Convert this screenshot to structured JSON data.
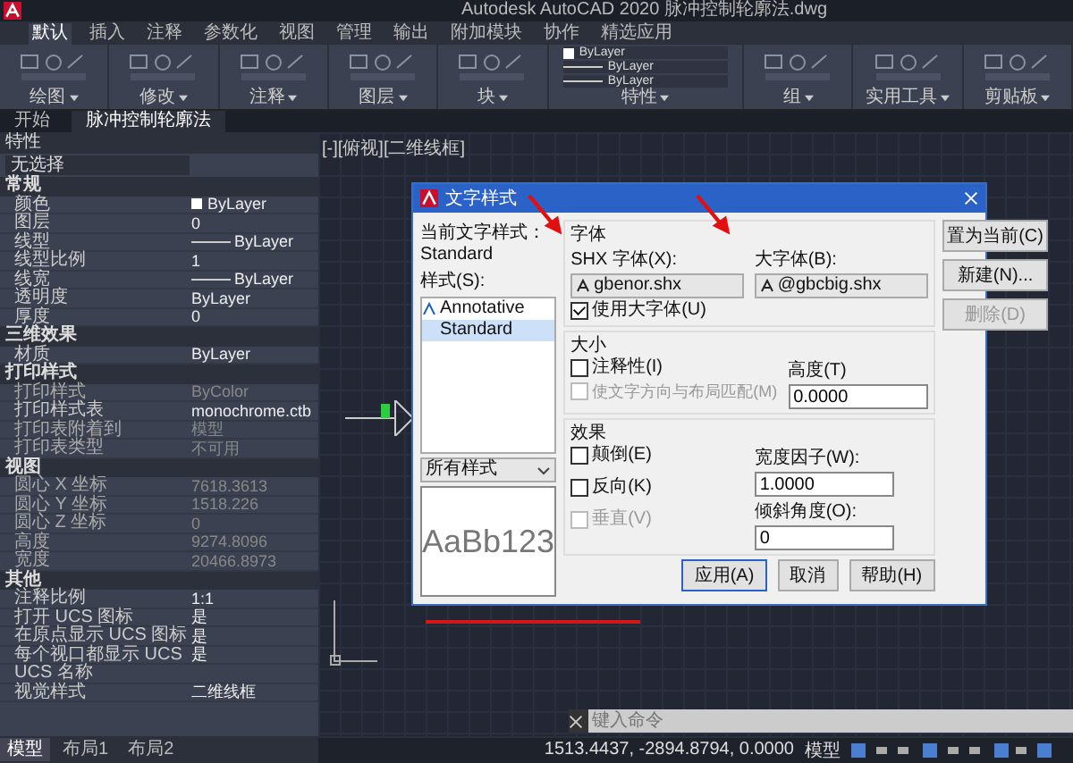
{
  "window": {
    "title": "Autodesk AutoCAD 2020  脉冲控制轮廓法.dwg"
  },
  "menu_tabs": [
    {
      "label": "默认",
      "selected": true
    },
    {
      "label": "插入",
      "selected": false
    },
    {
      "label": "注释",
      "selected": false
    },
    {
      "label": "参数化",
      "selected": false
    },
    {
      "label": "视图",
      "selected": false
    },
    {
      "label": "管理",
      "selected": false
    },
    {
      "label": "输出",
      "selected": false
    },
    {
      "label": "附加模块",
      "selected": false
    },
    {
      "label": "协作",
      "selected": false
    },
    {
      "label": "精选应用",
      "selected": false
    }
  ],
  "ribbon_panels": [
    "绘图",
    "修改",
    "注释",
    "图层",
    "块",
    "特性",
    "组",
    "实用工具",
    "剪贴板"
  ],
  "ribbon_properties": [
    "ByLayer",
    "ByLayer",
    "ByLayer"
  ],
  "doc_tabs": [
    {
      "label": "开始",
      "selected": false
    },
    {
      "label": "脉冲控制轮廓法",
      "selected": true
    }
  ],
  "properties": {
    "title": "特性",
    "selection": "无选择",
    "sections": [
      {
        "name": "常规",
        "rows": [
          {
            "name": "颜色",
            "value": "ByLayer",
            "kind": "color",
            "disabled": false
          },
          {
            "name": "图层",
            "value": "0",
            "kind": "text",
            "disabled": false
          },
          {
            "name": "线型",
            "value": "ByLayer",
            "kind": "line",
            "disabled": false
          },
          {
            "name": "线型比例",
            "value": "1",
            "kind": "text",
            "disabled": false
          },
          {
            "name": "线宽",
            "value": "ByLayer",
            "kind": "line",
            "disabled": false
          },
          {
            "name": "透明度",
            "value": "ByLayer",
            "kind": "text",
            "disabled": false
          },
          {
            "name": "厚度",
            "value": "0",
            "kind": "text",
            "disabled": false
          }
        ]
      },
      {
        "name": "三维效果",
        "rows": [
          {
            "name": "材质",
            "value": "ByLayer",
            "kind": "text",
            "disabled": false
          }
        ]
      },
      {
        "name": "打印样式",
        "rows": [
          {
            "name": "打印样式",
            "value": "ByColor",
            "kind": "text",
            "disabled": true
          },
          {
            "name": "打印样式表",
            "value": "monochrome.ctb",
            "kind": "text",
            "disabled": false
          },
          {
            "name": "打印表附着到",
            "value": "模型",
            "kind": "text",
            "disabled": true
          },
          {
            "name": "打印表类型",
            "value": "不可用",
            "kind": "text",
            "disabled": true
          }
        ]
      },
      {
        "name": "视图",
        "rows": [
          {
            "name": "圆心 X 坐标",
            "value": "7618.3613",
            "kind": "text",
            "disabled": true
          },
          {
            "name": "圆心 Y 坐标",
            "value": "1518.226",
            "kind": "text",
            "disabled": true
          },
          {
            "name": "圆心 Z 坐标",
            "value": "0",
            "kind": "text",
            "disabled": true
          },
          {
            "name": "高度",
            "value": "9274.8096",
            "kind": "text",
            "disabled": true
          },
          {
            "name": "宽度",
            "value": "20466.8973",
            "kind": "text",
            "disabled": true
          }
        ]
      },
      {
        "name": "其他",
        "rows": [
          {
            "name": "注释比例",
            "value": "1:1",
            "kind": "text",
            "disabled": false
          },
          {
            "name": "打开 UCS 图标",
            "value": "是",
            "kind": "text",
            "disabled": false
          },
          {
            "name": "在原点显示 UCS 图标",
            "value": "是",
            "kind": "text",
            "disabled": false
          },
          {
            "name": "每个视口都显示 UCS",
            "value": "是",
            "kind": "text",
            "disabled": false
          },
          {
            "name": "UCS 名称",
            "value": "",
            "kind": "text",
            "disabled": false
          },
          {
            "name": "视觉样式",
            "value": "二维线框",
            "kind": "text",
            "disabled": false
          }
        ]
      }
    ]
  },
  "viewport_label": "[-][俯视][二维线框]",
  "dialog": {
    "title": "文字样式",
    "current_label": "当前文字样式：",
    "current_value": "Standard",
    "styles_label": "样式(S):",
    "styles": [
      {
        "label": "Annotative",
        "annotative": true,
        "selected": false
      },
      {
        "label": "Standard",
        "annotative": false,
        "selected": true
      }
    ],
    "filter": "所有样式",
    "preview": "AaBb123",
    "font_group": "字体",
    "shx_label": "SHX 字体(X):",
    "shx_value": "gbenor.shx",
    "big_label": "大字体(B):",
    "big_value": "@gbcbig.shx",
    "use_big": {
      "label": "使用大字体(U)",
      "checked": true
    },
    "size_group": "大小",
    "annotative": {
      "label": "注释性(I)",
      "checked": false
    },
    "match": {
      "label": "使文字方向与布局匹配(M)",
      "checked": false,
      "disabled": true
    },
    "height_label": "高度(T)",
    "height_value": "0.0000",
    "effects_group": "效果",
    "effects": [
      {
        "label": "颠倒(E)",
        "checked": false,
        "disabled": false
      },
      {
        "label": "反向(K)",
        "checked": false,
        "disabled": false
      },
      {
        "label": "垂直(V)",
        "checked": false,
        "disabled": true
      }
    ],
    "width_label": "宽度因子(W):",
    "width_value": "1.0000",
    "oblique_label": "倾斜角度(O):",
    "oblique_value": "0",
    "side_buttons": [
      {
        "label": "置为当前(C)",
        "disabled": false
      },
      {
        "label": "新建(N)...",
        "disabled": false
      },
      {
        "label": "删除(D)",
        "disabled": true
      }
    ],
    "bottom_buttons": [
      {
        "label": "应用(A)",
        "primary": true
      },
      {
        "label": "取消",
        "primary": false
      },
      {
        "label": "帮助(H)",
        "primary": false
      }
    ]
  },
  "command_line": {
    "placeholder": "键入命令"
  },
  "status_bar": {
    "coordinates": "1513.4437, -2894.8794, 0.0000",
    "mode": "模型"
  },
  "layout_tabs": [
    {
      "label": "模型",
      "selected": true
    },
    {
      "label": "布局1",
      "selected": false
    },
    {
      "label": "布局2",
      "selected": false
    }
  ]
}
